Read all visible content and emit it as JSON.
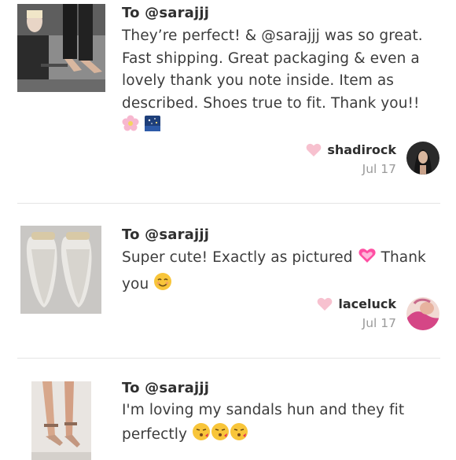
{
  "colors": {
    "heart_pink": "#f7c1cf",
    "divider": "#e4e4e4",
    "text": "#3c3c3c",
    "date": "#9a9a9a"
  },
  "reviews": [
    {
      "to": "To @sarajjj",
      "message": "They’re perfect! & @sarajjj was so great. Fast shipping. Great packaging & even a lovely thank you note inside. Item as described. Shoes true to fit. Thank you!!",
      "emojis": [
        "cherry-blossom-emoji",
        "night-sky-emoji"
      ],
      "author": "shadirock",
      "date": "Jul 17",
      "thumbnail_icon": "shoe-photo-heels",
      "avatar_icon": "user-avatar-photo"
    },
    {
      "to": "To @sarajjj",
      "message_part1": "Super cute! Exactly as pictured",
      "message_part2": "Thank you",
      "emojis": [
        "sparkling-heart-emoji",
        "smiling-emoji"
      ],
      "author": "laceluck",
      "date": "Jul 17",
      "thumbnail_icon": "shoe-photo-mules",
      "avatar_icon": "user-avatar-photo"
    },
    {
      "to": "To @sarajjj",
      "message": "I'm loving my sandals hun and they fit perfectly",
      "emojis": [
        "kissing-face-emoji",
        "kissing-face-emoji",
        "kissing-face-emoji"
      ],
      "thumbnail_icon": "shoe-photo-sandals"
    }
  ]
}
